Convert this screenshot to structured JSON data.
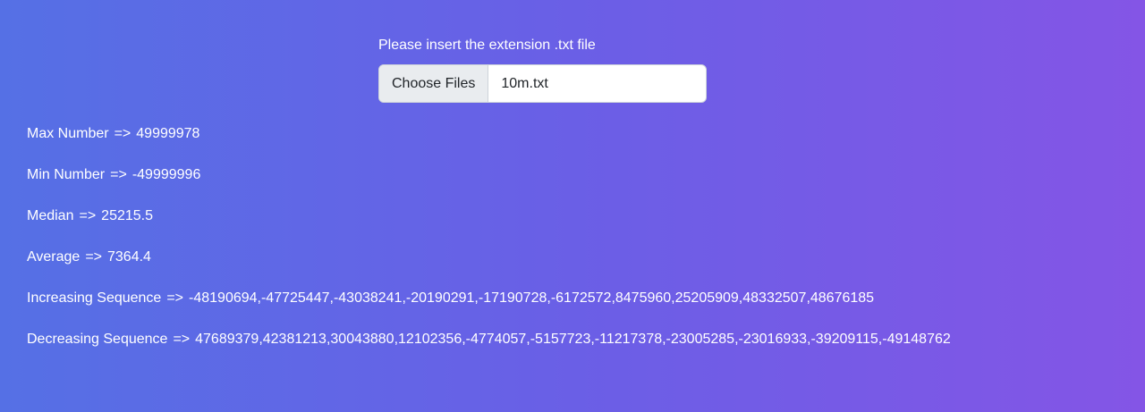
{
  "upload": {
    "label": "Please insert the extension .txt file",
    "button_label": "Choose Files",
    "file_name": "10m.txt"
  },
  "results": {
    "max": {
      "label": "Max Number",
      "arrow": "=>",
      "value": "49999978"
    },
    "min": {
      "label": "Min Number",
      "arrow": "=>",
      "value": "-49999996"
    },
    "median": {
      "label": "Median",
      "arrow": "=>",
      "value": "25215.5"
    },
    "average": {
      "label": "Average",
      "arrow": "=>",
      "value": "7364.4"
    },
    "increasing": {
      "label": "Increasing Sequence",
      "arrow": "=>",
      "value": "-48190694,-47725447,-43038241,-20190291,-17190728,-6172572,8475960,25205909,48332507,48676185"
    },
    "decreasing": {
      "label": "Decreasing Sequence",
      "arrow": "=>",
      "value": "47689379,42381213,30043880,12102356,-4774057,-5157723,-11217378,-23005285,-23016933,-39209115,-49148762"
    }
  },
  "colors": {
    "gradient_start": "#5570e5",
    "gradient_end": "#8455e6",
    "text": "#ffffff"
  }
}
